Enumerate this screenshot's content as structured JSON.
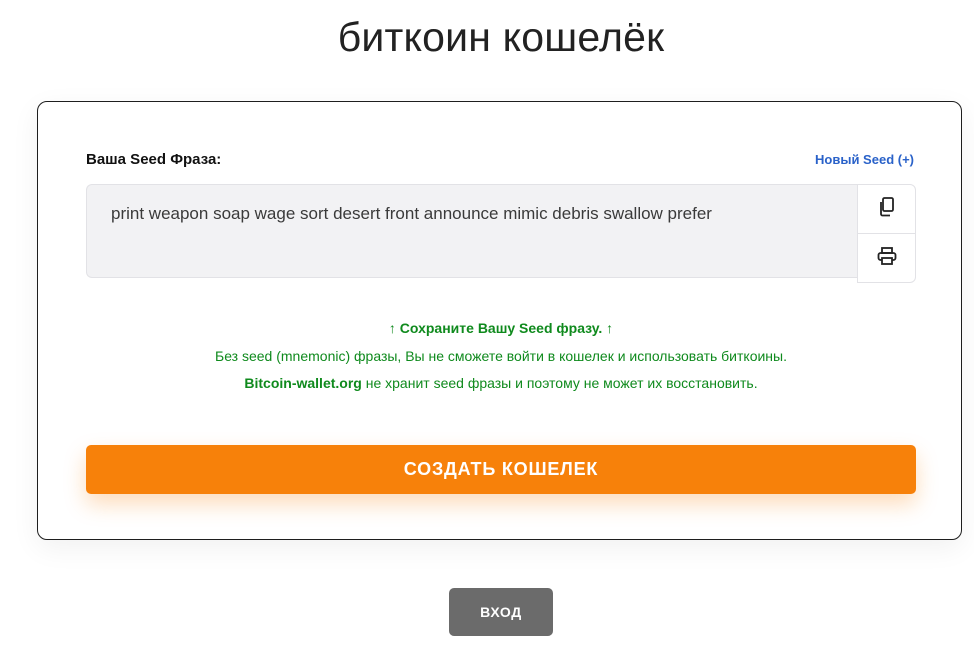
{
  "page": {
    "title": "биткоин кошелёк"
  },
  "seed_card": {
    "label": "Ваша Seed Фраза:",
    "new_seed_link": "Новый Seed (+)",
    "phrase": "print weapon soap wage sort desert front announce mimic debris swallow prefer",
    "copy_icon": "copy-icon",
    "print_icon": "printer-icon"
  },
  "notice": {
    "line1": "↑ Сохраните Вашу Seed фразу. ↑",
    "line2": "Без seed (mnemonic) фразы, Вы не сможете войти в кошелек и использовать биткоины.",
    "line3_brand": "Bitcoin-wallet.org",
    "line3_rest": " не хранит seed фразы и поэтому не может их восстановить."
  },
  "actions": {
    "create_wallet": "СОЗДАТЬ КОШЕЛЕК",
    "login": "ВХОД"
  },
  "colors": {
    "primary_orange": "#f7810a",
    "notice_green": "#0f8a1d",
    "link_blue": "#2a62c9",
    "login_gray": "#6b6b6b"
  }
}
